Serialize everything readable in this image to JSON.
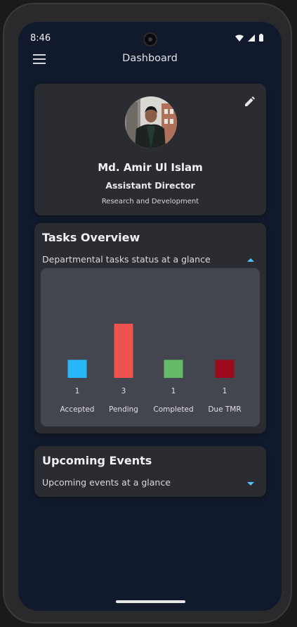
{
  "status_bar": {
    "time": "8:46",
    "icons": [
      "wifi-icon",
      "cellular-signal-icon",
      "battery-icon"
    ]
  },
  "app_bar": {
    "menu_icon": "hamburger-menu-icon",
    "title": "Dashboard"
  },
  "profile": {
    "name": "Md. Amir Ul Islam",
    "role": "Assistant Director",
    "department": "Research and Development",
    "edit_icon": "pencil-edit-icon"
  },
  "tasks": {
    "title": "Tasks Overview",
    "subtitle": "Departmental tasks status at a glance",
    "expanded": true
  },
  "chart_data": {
    "type": "bar",
    "categories": [
      "Accepted",
      "Pending",
      "Completed",
      "Due TMR"
    ],
    "values": [
      1,
      3,
      1,
      1
    ],
    "value_labels": [
      "1",
      "3",
      "1",
      "1"
    ],
    "colors": [
      "#29b6f6",
      "#ef5350",
      "#66bb6a",
      "#9b0a1c"
    ],
    "ylim": [
      0,
      3
    ],
    "grid": false,
    "legend": "none"
  },
  "events": {
    "title": "Upcoming Events",
    "subtitle": "Upcoming events at a glance",
    "expanded": false
  },
  "colors": {
    "background": "#111a2c",
    "card": "#2b2c31",
    "chart_panel": "#44464f",
    "accent": "#4fc3f7"
  }
}
